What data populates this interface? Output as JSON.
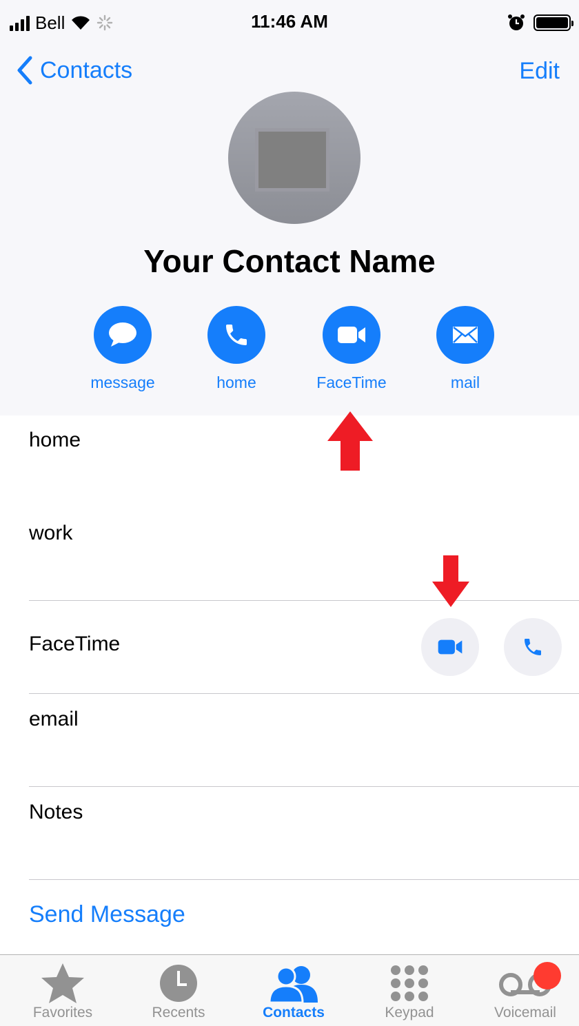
{
  "status_bar": {
    "carrier": "Bell",
    "time": "11:46 AM"
  },
  "nav": {
    "back_label": "Contacts",
    "edit_label": "Edit"
  },
  "contact": {
    "name": "Your Contact Name"
  },
  "actions": [
    {
      "label": "message",
      "icon": "message-bubble-icon"
    },
    {
      "label": "home",
      "icon": "phone-icon"
    },
    {
      "label": "FaceTime",
      "icon": "video-camera-icon"
    },
    {
      "label": "mail",
      "icon": "envelope-icon"
    }
  ],
  "rows": [
    {
      "label": "home"
    },
    {
      "label": "work"
    },
    {
      "label": "FaceTime"
    },
    {
      "label": "email"
    },
    {
      "label": "Notes"
    }
  ],
  "send_message": "Send Message",
  "tabs": [
    {
      "label": "Favorites",
      "icon": "star-icon",
      "active": false
    },
    {
      "label": "Recents",
      "icon": "clock-icon",
      "active": false
    },
    {
      "label": "Contacts",
      "icon": "contacts-icon",
      "active": true
    },
    {
      "label": "Keypad",
      "icon": "keypad-icon",
      "active": false
    },
    {
      "label": "Voicemail",
      "icon": "voicemail-icon",
      "active": false
    }
  ],
  "colors": {
    "accent": "#157efb",
    "header_bg": "#f7f7fa",
    "badge": "#ff3b30",
    "annotation_arrow": "#ee1c25"
  }
}
